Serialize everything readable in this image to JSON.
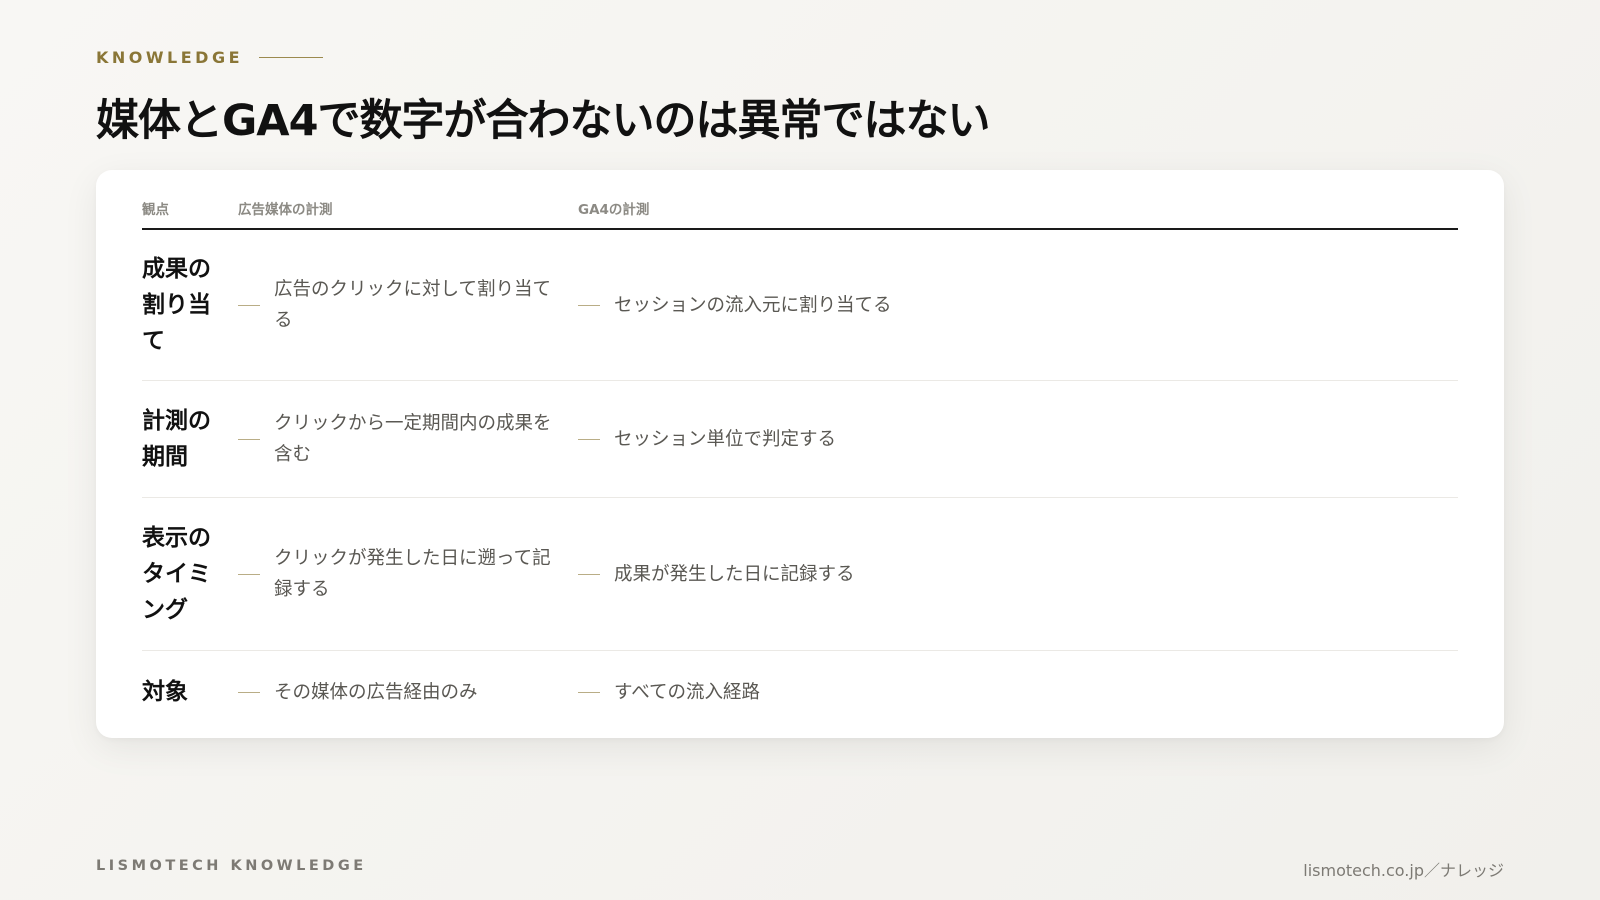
{
  "header": {
    "eyebrow": "KNOWLEDGE",
    "title": "媒体とGA4で数字が合わないのは異常ではない"
  },
  "table": {
    "columns": [
      "観点",
      "広告媒体の計測",
      "GA4の計測"
    ],
    "rows": [
      {
        "aspect": "成果の割り当て",
        "media": "広告のクリックに対して割り当てる",
        "ga4": "セッションの流入元に割り当てる"
      },
      {
        "aspect": "計測の期間",
        "media": "クリックから一定期間内の成果を含む",
        "ga4": "セッション単位で判定する"
      },
      {
        "aspect": "表示のタイミング",
        "media": "クリックが発生した日に遡って記録する",
        "ga4": "成果が発生した日に記録する"
      },
      {
        "aspect": "対象",
        "media": "その媒体の広告経由のみ",
        "ga4": "すべての流入経路"
      }
    ]
  },
  "footer": {
    "brand": "LISMOTECH KNOWLEDGE",
    "url": "lismotech.co.jp／ナレッジ"
  },
  "colors": {
    "accent": "#8a7637",
    "background": "#f4f3ef",
    "card": "#ffffff",
    "title": "#111111",
    "body_text": "#5a5853"
  }
}
